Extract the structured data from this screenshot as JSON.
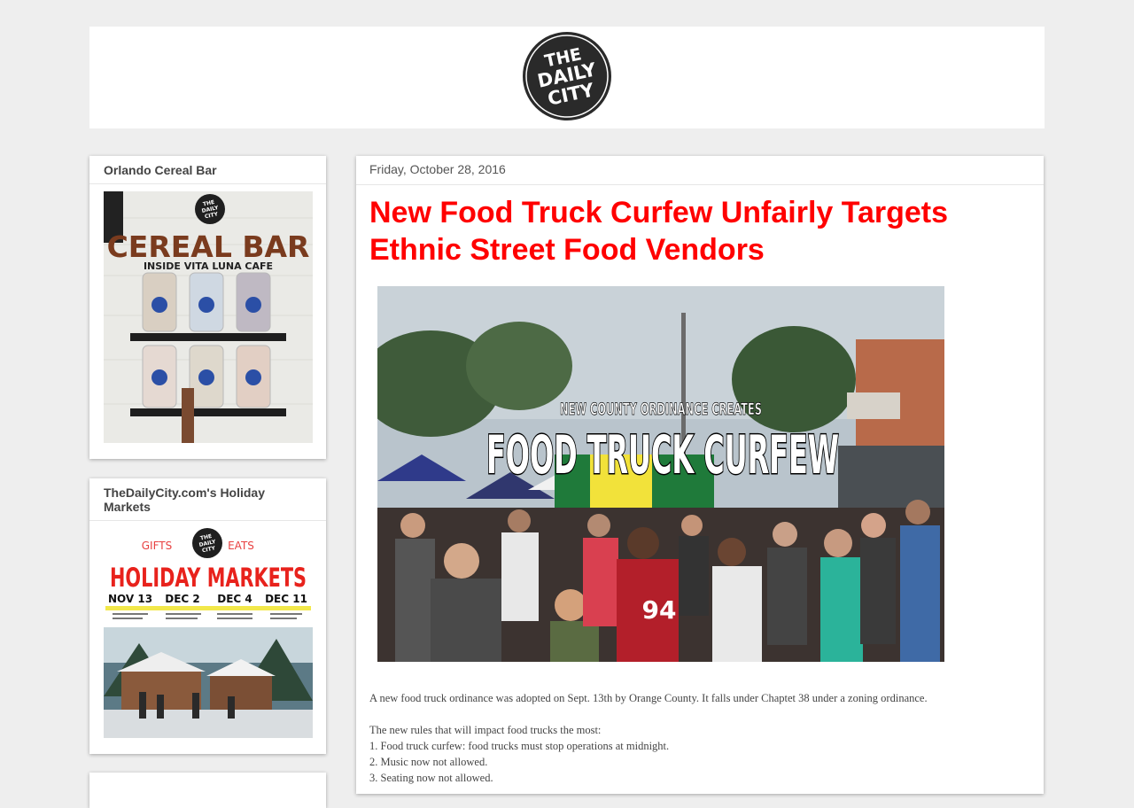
{
  "header": {
    "logo_text": [
      "THE",
      "DAILY",
      "CITY"
    ]
  },
  "sidebar": {
    "widgets": [
      {
        "title": "Orlando Cereal Bar",
        "image": {
          "logo_text": [
            "THE",
            "DAILY",
            "CITY"
          ],
          "headline": "CEREAL BAR",
          "subline": "INSIDE VITA LUNA CAFE"
        }
      },
      {
        "title": "TheDailyCity.com's Holiday Markets",
        "image": {
          "left_word": "GIFTS",
          "right_word": "EATS",
          "logo_text": [
            "THE",
            "DAILY",
            "CITY"
          ],
          "headline": "HOLIDAY MARKETS",
          "dates": [
            "NOV 13",
            "DEC 2",
            "DEC 4",
            "DEC 11"
          ]
        }
      }
    ]
  },
  "post": {
    "date": "Friday, October 28, 2016",
    "title": "New Food Truck Curfew Unfairly Targets Ethnic Street Food Vendors",
    "image": {
      "line1": "NEW COUNTY ORDINANCE CREATES",
      "line2": "FOOD TRUCK CURFEW",
      "jersey_number": "94"
    },
    "paragraph1": "A new food truck ordinance was adopted on Sept. 13th by Orange County. It falls under Chaptet 38 under a zoning ordinance.",
    "list_intro": "The new rules that will impact food trucks the most:",
    "rules": [
      "1. Food truck curfew: food trucks must stop operations at midnight.",
      "2. Music now not allowed.",
      "3. Seating now not allowed."
    ]
  },
  "colors": {
    "page_bg": "#eeeeee",
    "title_red": "#ff0000",
    "text_gray": "#444444"
  }
}
